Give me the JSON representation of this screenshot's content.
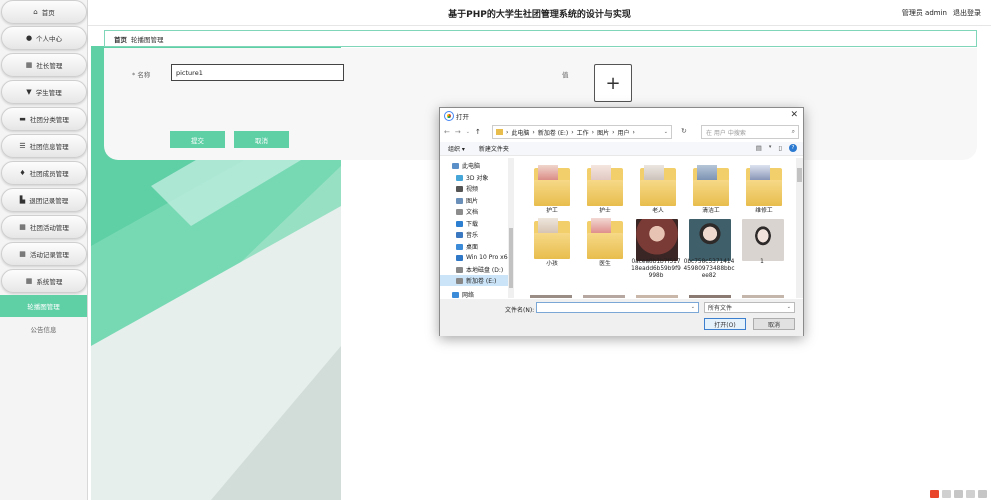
{
  "sidebar": {
    "items": [
      {
        "label": "首页",
        "icon": "home-icon",
        "glyph": "⌂"
      },
      {
        "label": "个人中心",
        "icon": "user-icon",
        "glyph": "●"
      },
      {
        "label": "社长管理",
        "icon": "grid-icon",
        "glyph": "▦"
      },
      {
        "label": "学生管理",
        "icon": "student-icon",
        "glyph": "▼"
      },
      {
        "label": "社团分类管理",
        "icon": "category-icon",
        "glyph": "▬"
      },
      {
        "label": "社团信息管理",
        "icon": "list-icon",
        "glyph": "☰"
      },
      {
        "label": "社团成员管理",
        "icon": "pin-icon",
        "glyph": "♦"
      },
      {
        "label": "退团记录管理",
        "icon": "record-icon",
        "glyph": "▙"
      },
      {
        "label": "社团活动管理",
        "icon": "grid-icon",
        "glyph": "▦"
      },
      {
        "label": "活动记录管理",
        "icon": "grid-icon",
        "glyph": "▦"
      },
      {
        "label": "系统管理",
        "icon": "grid-icon",
        "glyph": "▦"
      }
    ],
    "sub_items": [
      {
        "label": "轮播图管理",
        "active": true
      },
      {
        "label": "公告信息",
        "active": false
      }
    ]
  },
  "header": {
    "title": "基于PHP的大学生社团管理系统的设计与实现",
    "user": "管理员 admin",
    "logout": "退出登录"
  },
  "breadcrumb": {
    "home": "首页",
    "current": "轮播图管理"
  },
  "form": {
    "name_label": "* 名称",
    "name_value": "picture1",
    "value_label": "值",
    "upload_glyph": "+",
    "submit": "提交",
    "cancel": "取消"
  },
  "dialog": {
    "title": "打开",
    "close": "✕",
    "path": [
      "此电脑",
      "新加卷 (E:)",
      "工作",
      "图片",
      "用户"
    ],
    "search_placeholder": "在 用户 中搜索",
    "organize": "组织 ▾",
    "new_folder": "新建文件夹",
    "nav_items": [
      {
        "label": "此电脑",
        "icon_color": "#5b8fc7"
      },
      {
        "label": "3D 对象",
        "icon_color": "#46a6d8"
      },
      {
        "label": "视频",
        "icon_color": "#555555"
      },
      {
        "label": "图片",
        "icon_color": "#6a8fb8"
      },
      {
        "label": "文档",
        "icon_color": "#8c8c8c"
      },
      {
        "label": "下载",
        "icon_color": "#2d7fd1"
      },
      {
        "label": "音乐",
        "icon_color": "#3a78c2"
      },
      {
        "label": "桌面",
        "icon_color": "#3b8bd8"
      },
      {
        "label": "Win 10 Pro x64",
        "icon_color": "#2f78c7"
      },
      {
        "label": "本地磁盘 (D:)",
        "icon_color": "#888888"
      },
      {
        "label": "新加卷 (E:)",
        "icon_color": "#888888",
        "selected": true
      },
      {
        "label": "网络",
        "icon_color": "#3b8bd8"
      }
    ],
    "files": [
      {
        "name": "护工",
        "kind": "folder"
      },
      {
        "name": "护士",
        "kind": "folder"
      },
      {
        "name": "老人",
        "kind": "folder"
      },
      {
        "name": "清洁工",
        "kind": "folder"
      },
      {
        "name": "维修工",
        "kind": "folder"
      },
      {
        "name": "小孩",
        "kind": "folder"
      },
      {
        "name": "医生",
        "kind": "folder"
      },
      {
        "name": "0acea8b1b7f51718eadd6b59b9f9998b",
        "kind": "image",
        "color": "#7a3a35"
      },
      {
        "name": "0bc758c537141445980973488bbcee82",
        "kind": "image",
        "color": "#3f5f6a"
      },
      {
        "name": "1",
        "kind": "image",
        "color": "#c9c2bd"
      }
    ],
    "filename_label": "文件名(N):",
    "filetype": "所有文件",
    "open": "打开(O)",
    "cancel": "取消"
  },
  "colors": {
    "accent": "#5fcfa6",
    "border": "#7fd6b8"
  }
}
